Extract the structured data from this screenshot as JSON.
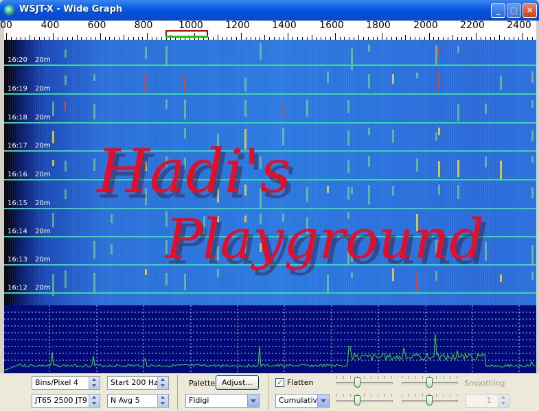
{
  "window": {
    "title": "WSJT-X - Wide Graph",
    "minimize_icon": "minimize-icon",
    "maximize_icon": "maximize-icon",
    "close_icon": "close-icon"
  },
  "scale": {
    "labels": [
      "00",
      "400",
      "600",
      "800",
      "1000",
      "1200",
      "1400",
      "1600",
      "1800",
      "2000",
      "2200",
      "2400"
    ]
  },
  "waterfall": {
    "rows": [
      {
        "time": "16:20",
        "band": "20m"
      },
      {
        "time": "16:19",
        "band": "20m"
      },
      {
        "time": "16:18",
        "band": "20m"
      },
      {
        "time": "16:17",
        "band": "20m"
      },
      {
        "time": "16:16",
        "band": "20m"
      },
      {
        "time": "16:15",
        "band": "20m"
      },
      {
        "time": "16:14",
        "band": "20m"
      },
      {
        "time": "16:13",
        "band": "20m"
      },
      {
        "time": "16:12",
        "band": "20m"
      }
    ],
    "watermark_line1": "Hadi's",
    "watermark_line2": "Playground"
  },
  "controls": {
    "bins_pixel": "Bins/Pixel  4",
    "mode": "JT65  2500  JT9",
    "start": "Start 200 Hz",
    "navg": "N Avg 5",
    "palette_label": "Palette",
    "adjust_button": "Adjust...",
    "palette_value": "Fldigi",
    "flatten_label": "Flatten",
    "flatten_checked": true,
    "cumulative_value": "Cumulative",
    "smoothing_label": "Smoothing",
    "smoothing_value": "1"
  },
  "colors": {
    "waterfall_blue": "#2a78e0",
    "spectrum_bg": "#000a78",
    "trace": "#3adc3a",
    "watermark": "#e0102a"
  }
}
